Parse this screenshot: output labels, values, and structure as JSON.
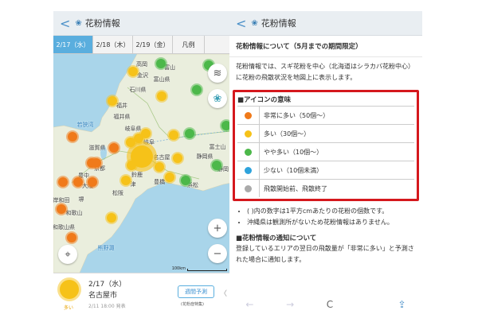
{
  "left": {
    "header": {
      "back": "<",
      "logo": "❀",
      "title": "花粉情報"
    },
    "tabs": [
      "2/17（水）",
      "2/18（木）",
      "2/19（金）",
      "凡例"
    ],
    "map": {
      "labels": [
        "高岡",
        "富山",
        "金沢",
        "富山県",
        "石川県",
        "福井",
        "福井県",
        "若狭湾",
        "岐阜県",
        "岐阜",
        "滋賀県",
        "名古屋",
        "富士山",
        "静岡県",
        "京都",
        "静岡",
        "豊中",
        "鈴鹿",
        "大阪",
        "津",
        "豊橋",
        "浜松",
        "松阪",
        "岸和田",
        "堺",
        "和歌山",
        "和歌山県",
        "熊野灘"
      ],
      "scale": "100km",
      "zoom_in": "+",
      "zoom_out": "−"
    },
    "info": {
      "date": "2/17（水）",
      "city": "名古屋市",
      "level": "多い",
      "published": "2/11 18:00 発表",
      "weekly_button": "週間予測",
      "weekly_sub": "(花粉症特集)",
      "side": "〈"
    }
  },
  "right": {
    "header": {
      "back": "<",
      "logo": "❀",
      "title": "花粉情報"
    },
    "title": "花粉情報について（5月までの期間限定）",
    "intro": "花粉情報では、スギ花粉を中心（北海道はシラカバ花粉中心）に花粉の飛散状況を地図上に表示します。",
    "legend": {
      "heading": "■アイコンの意味",
      "items": [
        {
          "label": "非常に多い（50個〜）",
          "color": "#f07a1a"
        },
        {
          "label": "多い（30個〜）",
          "color": "#f6c219"
        },
        {
          "label": "やや多い（10個〜）",
          "color": "#4cb84a"
        },
        {
          "label": "少ない（10個未満）",
          "color": "#2ea3dc"
        },
        {
          "label": "飛散開始前、飛散終了",
          "color": "#aaaaaa"
        }
      ]
    },
    "notes": [
      "( )内の数字は1平方cmあたりの花粉の個数です。",
      "沖縄県は観測所がないため花粉情報はありません。"
    ],
    "notify": {
      "heading": "■花粉情報の通知について",
      "text": "登録しているエリアの翌日の飛散量が「非常に多い」と予測された場合に通知します。"
    },
    "nav": {
      "back": "←",
      "forward": "→",
      "reload": "C",
      "share": "⇪"
    }
  }
}
